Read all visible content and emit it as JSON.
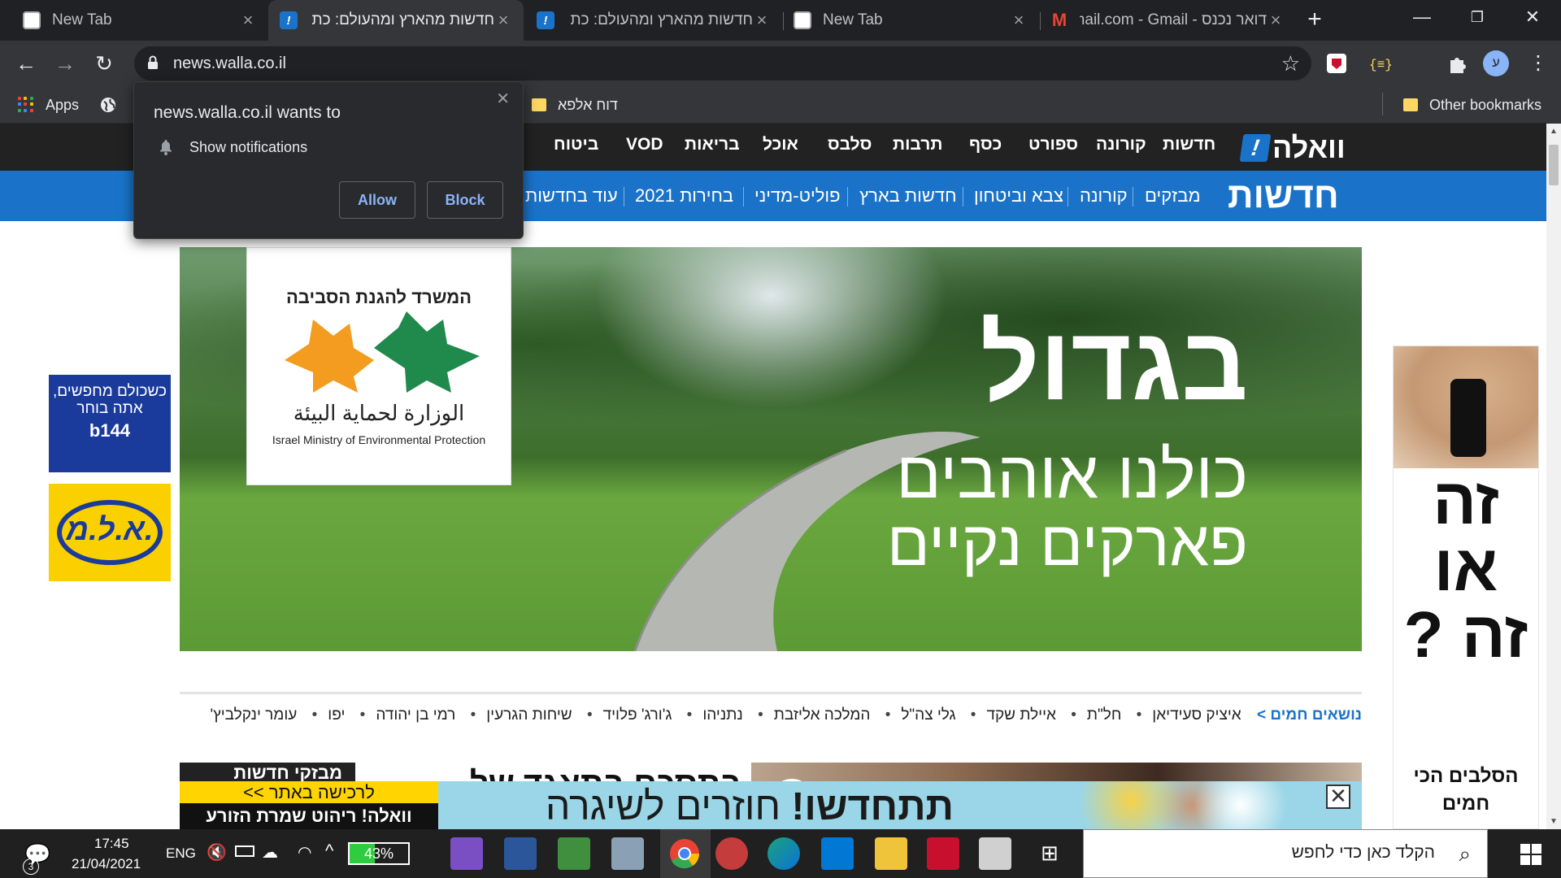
{
  "browser": {
    "tabs": [
      {
        "title": "New Tab",
        "favicon": "chrome-newtab-icon",
        "active": false
      },
      {
        "title": "חדשות מהארץ ומהעולם: כת",
        "favicon": "walla-icon",
        "active": true
      },
      {
        "title": "חדשות מהארץ ומהעולם: כת",
        "favicon": "walla-icon",
        "active": false
      },
      {
        "title": "New Tab",
        "favicon": "chrome-newtab-icon",
        "active": false
      },
      {
        "title": "דואר נכנס - mail.com - Gmail",
        "favicon": "gmail-icon",
        "active": false
      }
    ],
    "new_tab_label": "+",
    "window_controls": {
      "minimize": "—",
      "restore": "❐",
      "close": "✕"
    },
    "url": "news.walla.co.il",
    "profile_initial": "ע",
    "bookmarks": {
      "apps_label": "Apps",
      "items": [
        {
          "label": "דוח אלפא"
        }
      ],
      "other_label": "Other bookmarks"
    }
  },
  "permission_popup": {
    "title": "news.walla.co.il wants to",
    "permission": "Show notifications",
    "allow_label": "Allow",
    "block_label": "Block"
  },
  "site": {
    "logo_text": "וואלה",
    "logo_mark": "!",
    "top_nav": [
      "חדשות",
      "קורונה",
      "ספורט",
      "כסף",
      "תרבות",
      "סלבס",
      "אוכל",
      "בריאות",
      "VOD",
      "ביטוח"
    ],
    "section_title": "חדשות",
    "sub_nav": [
      "מבזקים",
      "קורונה",
      "צבא וביטחון",
      "חדשות בארץ",
      "פוליט-מדיני",
      "בחירות 2021",
      "עוד בחדשות"
    ],
    "banner": {
      "ministry_heb": "המשרד להגנת הסביבה",
      "ministry_ar": "الوزارة لحماية البيئة",
      "ministry_en": "Israel Ministry of Environmental Protection",
      "line1": "בגדול",
      "line2": "כולנו אוהבים",
      "line3": "פארקים נקיים"
    },
    "ad_left1": {
      "text": "כשכולם מחפשים, אתה בוחר",
      "brand": "b144"
    },
    "ad_left2": {
      "text": "א.ל.מ."
    },
    "ad_right": {
      "big": "זה או זה ?",
      "small": "הסלבים הכי חמים"
    },
    "hot_topics": {
      "label": "נושאים חמים >",
      "items": [
        "איציק סעידיאן",
        "חל\"ת",
        "איילת שקד",
        "גלי צה\"ל",
        "המלכה אליזבת",
        "נתניהו",
        "ג'ורג' פלויד",
        "שיחות הגרעין",
        "רמי בן יהודה",
        "יפו",
        "עומר ינקלביץ'"
      ]
    },
    "flash_label": "מבזקי חדשות",
    "headline_partial": "בתסכם בתאגד של",
    "sticky_ad": {
      "top_label": "לרכישה באתר >>",
      "brand_line": "וואלה! ריהוט שמרת הזורע",
      "message_regular": "חוזרים לשיגרה",
      "message_bold": "תתחדשו!",
      "close": "✕"
    }
  },
  "taskbar": {
    "search_placeholder": "הקלד כאן כדי לחפש",
    "time": "17:45",
    "date": "21/04/2021",
    "language": "ENG",
    "battery": "43%",
    "notifications_count": "3"
  }
}
